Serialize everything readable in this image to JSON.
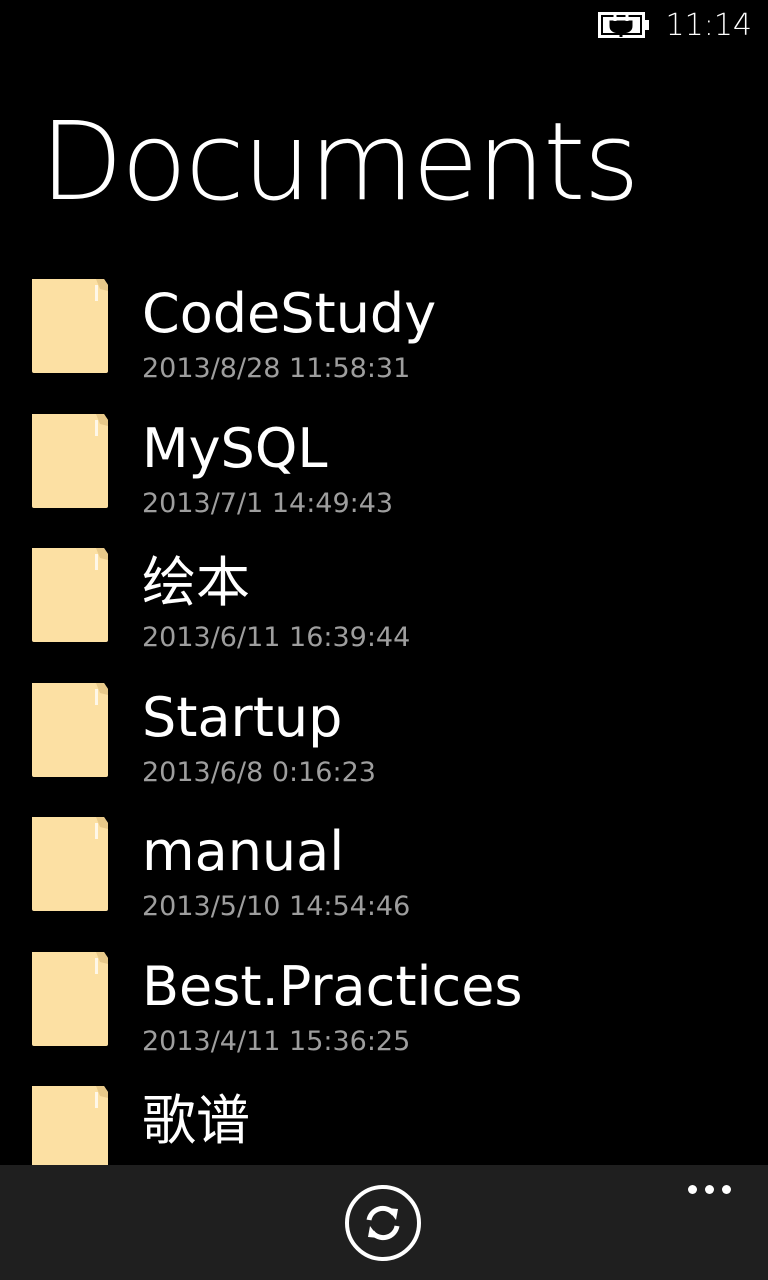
{
  "status_bar": {
    "time": "11:14",
    "battery_icon": "battery-charging-icon"
  },
  "page": {
    "title": "Documents"
  },
  "items": [
    {
      "name": "CodeStudy",
      "date": "2013/8/28 11:58:31",
      "icon": "folder-icon"
    },
    {
      "name": "MySQL",
      "date": "2013/7/1 14:49:43",
      "icon": "folder-icon"
    },
    {
      "name": "绘本",
      "date": "2013/6/11 16:39:44",
      "icon": "folder-icon"
    },
    {
      "name": "Startup",
      "date": "2013/6/8 0:16:23",
      "icon": "folder-icon"
    },
    {
      "name": "manual",
      "date": "2013/5/10 14:54:46",
      "icon": "folder-icon"
    },
    {
      "name": "Best.Practices",
      "date": "2013/4/11 15:36:25",
      "icon": "folder-icon"
    },
    {
      "name": "歌谱",
      "date": "",
      "icon": "folder-icon"
    }
  ],
  "app_bar": {
    "refresh_icon": "refresh-icon",
    "more_icon": "more-ellipsis-icon"
  },
  "colors": {
    "background": "#000000",
    "folder": "#fce0a3",
    "secondary_text": "#9e9e9e",
    "app_bar": "#1f1f1f"
  }
}
